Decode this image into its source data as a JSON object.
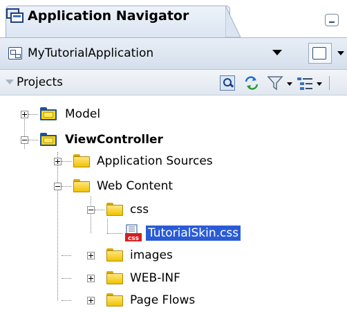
{
  "header": {
    "title": "Application Navigator"
  },
  "application": {
    "selected": "MyTutorialApplication"
  },
  "projects": {
    "label": "Projects"
  },
  "tree": {
    "model": "Model",
    "viewcontroller": "ViewController",
    "app_sources": "Application Sources",
    "web_content": "Web Content",
    "css_folder": "css",
    "css_file": "TutorialSkin.css",
    "css_badge": "css",
    "images": "images",
    "webinf": "WEB-INF",
    "page_flows": "Page Flows"
  },
  "colors": {
    "selection": "#2a5bd7",
    "folder": "#f2c200",
    "project_folder_border": "#1f4fa0"
  }
}
